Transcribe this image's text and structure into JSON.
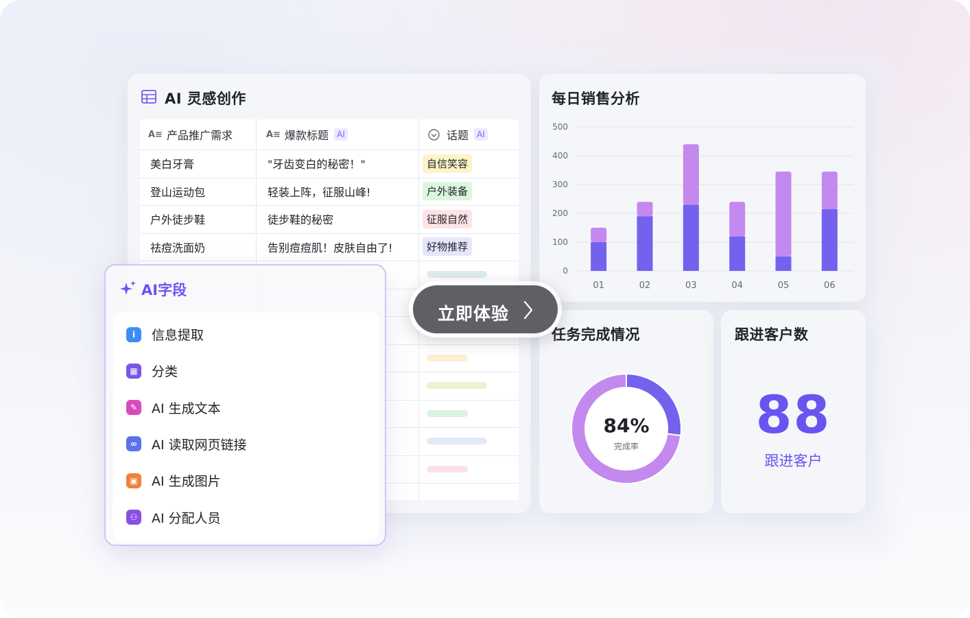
{
  "ai_card": {
    "title": "AI 灵感创作",
    "columns": [
      {
        "label": "产品推广需求",
        "icon": "text-field-icon",
        "ai": false
      },
      {
        "label": "爆款标题",
        "icon": "text-field-icon",
        "ai": true
      },
      {
        "label": "话题",
        "icon": "single-select-icon",
        "ai": true
      }
    ],
    "ai_tag": "AI",
    "rows": [
      {
        "product": "美白牙膏",
        "title": "\"牙齿变白的秘密！\"",
        "topic": "自信笑容",
        "topic_color": "#fdf3c8"
      },
      {
        "product": "登山运动包",
        "title": "轻装上阵，征服山峰!",
        "topic": "户外装备",
        "topic_color": "#dcf5df"
      },
      {
        "product": "户外徒步鞋",
        "title": "徒步鞋的秘密",
        "topic": "征服自然",
        "topic_color": "#fde3e6"
      },
      {
        "product": "祛痘洗面奶",
        "title": "告别痘痘肌！皮肤自由了!",
        "topic": "好物推荐",
        "topic_color": "#e6e6fb"
      }
    ],
    "placeholder_colors": [
      "#dcecef",
      "#e2e4f3",
      "#fadbdb",
      "#fcefd2",
      "#eaf3cf",
      "#dcf3dd",
      "#e4e9f6",
      "#fbe2ea"
    ]
  },
  "ai_field_popup": {
    "title": "AI字段",
    "items": [
      {
        "label": "信息提取",
        "icon": "info-extract-icon",
        "color": "#3e8df7",
        "glyph": "i"
      },
      {
        "label": "分类",
        "icon": "category-icon",
        "color": "#7b55e8",
        "glyph": "▦"
      },
      {
        "label": "AI 生成文本",
        "icon": "generate-text-icon",
        "color": "#d94bbd",
        "glyph": "✎"
      },
      {
        "label": "AI 读取网页链接",
        "icon": "read-link-icon",
        "color": "#5a72ec",
        "glyph": "∞"
      },
      {
        "label": "AI 生成图片",
        "icon": "generate-image-icon",
        "color": "#f0813b",
        "glyph": "▣"
      },
      {
        "label": "AI 分配人员",
        "icon": "assign-people-icon",
        "color": "#8a4fe6",
        "glyph": "⚇"
      }
    ]
  },
  "cta": {
    "label": "立即体验",
    "icon": "chevron-right-icon"
  },
  "sales_card": {
    "title": "每日销售分析"
  },
  "task_card": {
    "title": "任务完成情况",
    "value": "84%",
    "label": "完成率",
    "percent": 84
  },
  "follow_card": {
    "title": "跟进客户数",
    "value": "88",
    "label": "跟进客户"
  },
  "colors": {
    "primary": "#7462ee",
    "secondary": "#c489ee",
    "accent_text": "#6a54f0"
  },
  "chart_data": {
    "type": "bar",
    "stacked": true,
    "title": "每日销售分析",
    "categories": [
      "01",
      "02",
      "03",
      "04",
      "05",
      "06"
    ],
    "series": [
      {
        "values": [
          100,
          190,
          230,
          120,
          50,
          215
        ]
      },
      {
        "values": [
          50,
          50,
          210,
          120,
          295,
          130
        ]
      }
    ],
    "ylim": [
      0,
      500
    ],
    "yticks": [
      "500",
      "400",
      "300",
      "200",
      "100",
      "0"
    ],
    "grid": true
  }
}
